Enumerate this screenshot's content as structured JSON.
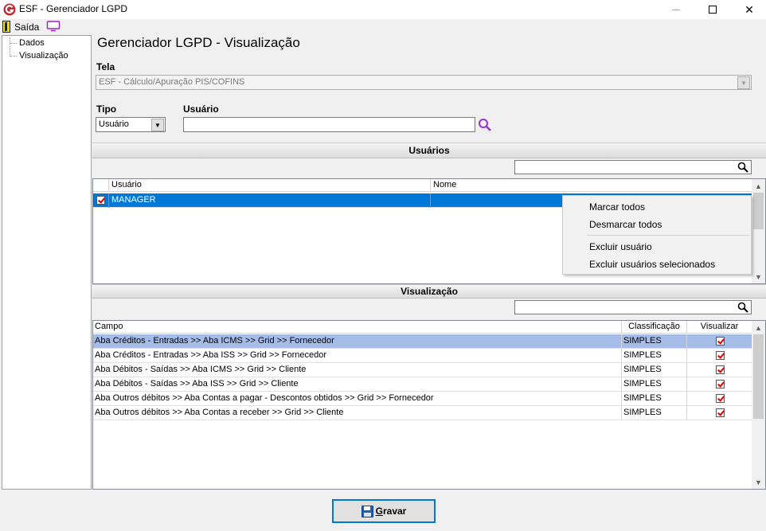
{
  "window": {
    "title": "ESF - Gerenciador LGPD",
    "minimize": "—",
    "maximize": "☐",
    "close": "✕"
  },
  "toolbar": {
    "exit_label": "Saída"
  },
  "tree": {
    "items": [
      {
        "label": "Dados"
      },
      {
        "label": "Visualização"
      }
    ]
  },
  "page": {
    "title": "Gerenciador LGPD - Visualização"
  },
  "form": {
    "tela_label": "Tela",
    "tela_value": "ESF - Cálculo/Apuração PIS/COFINS",
    "tipo_label": "Tipo",
    "tipo_value": "Usuário",
    "usuario_label": "Usuário",
    "usuario_value": ""
  },
  "users_section": {
    "title": "Usuários",
    "search_value": "",
    "columns": [
      "Usuário",
      "Nome"
    ],
    "rows": [
      {
        "checked": true,
        "usuario": "MANAGER",
        "nome": ""
      }
    ]
  },
  "context_menu": {
    "items": [
      "Marcar todos",
      "Desmarcar todos",
      "Excluir usuário",
      "Excluir usuários selecionados"
    ]
  },
  "view_section": {
    "title": "Visualização",
    "search_value": "",
    "columns": [
      "Campo",
      "Classificação",
      "Visualizar"
    ],
    "rows": [
      {
        "campo": "Aba Créditos - Entradas >> Aba ICMS >> Grid >> Fornecedor",
        "classificacao": "SIMPLES",
        "visualizar": true
      },
      {
        "campo": "Aba Créditos - Entradas >> Aba ISS >> Grid >> Fornecedor",
        "classificacao": "SIMPLES",
        "visualizar": true
      },
      {
        "campo": "Aba Débitos - Saídas >> Aba ICMS >> Grid >> Cliente",
        "classificacao": "SIMPLES",
        "visualizar": true
      },
      {
        "campo": "Aba Débitos - Saídas >> Aba ISS >> Grid >> Cliente",
        "classificacao": "SIMPLES",
        "visualizar": true
      },
      {
        "campo": "Aba Outros débitos >> Aba Contas a pagar - Descontos obtidos >> Grid >> Fornecedor",
        "classificacao": "SIMPLES",
        "visualizar": true
      },
      {
        "campo": "Aba Outros débitos >> Aba Contas a receber >> Grid >> Cliente",
        "classificacao": "SIMPLES",
        "visualizar": true
      }
    ]
  },
  "footer": {
    "save_label": "Gravar"
  },
  "colors": {
    "selection": "#0078d7",
    "row_highlight": "#a6bce8",
    "accent": "#c3262e"
  }
}
